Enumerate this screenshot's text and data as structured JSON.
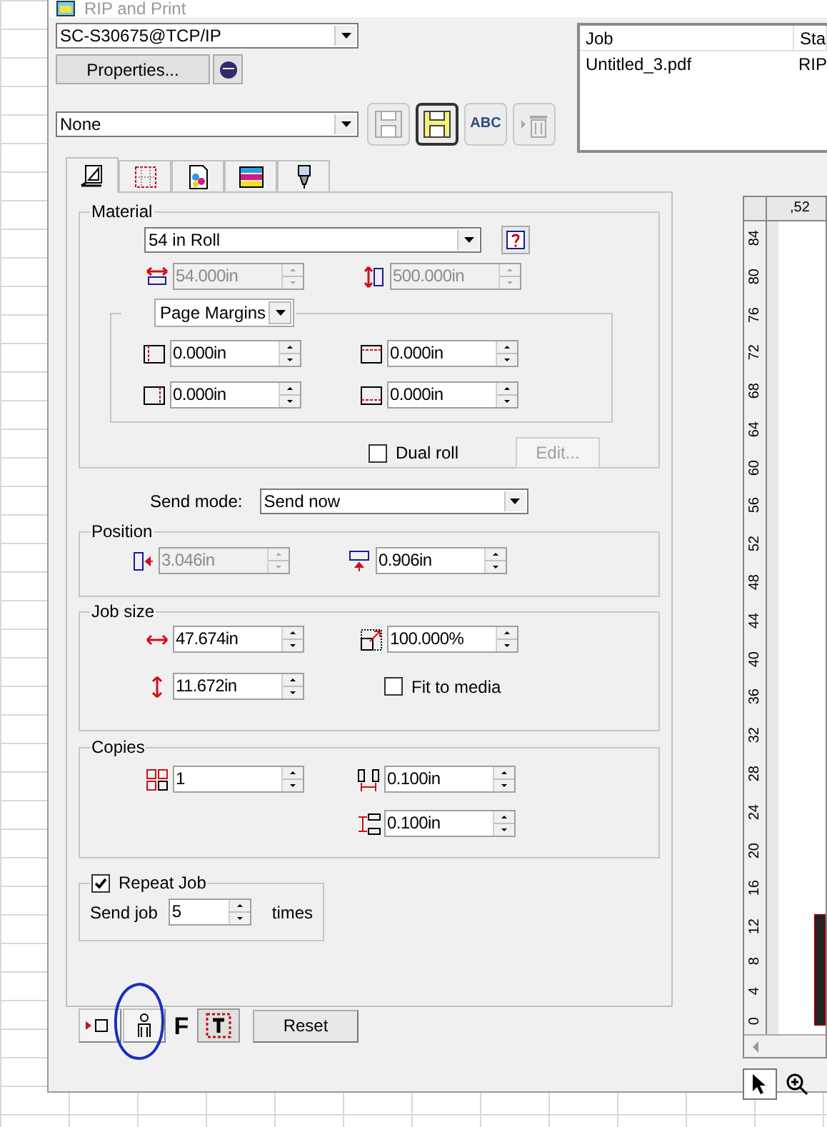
{
  "window": {
    "title": "RIP and Print"
  },
  "printer": {
    "value": "SC-S30675@TCP/IP"
  },
  "properties_button": "Properties...",
  "preset": {
    "value": "None"
  },
  "preset_tools": [
    {
      "kind": "save",
      "disabled": true,
      "selected": false
    },
    {
      "kind": "save-as",
      "disabled": false,
      "selected": true
    },
    {
      "kind": "rename",
      "label": "ABC",
      "disabled": false,
      "selected": false
    },
    {
      "kind": "delete",
      "disabled": true,
      "selected": false
    }
  ],
  "tabs": [
    {
      "kind": "layout",
      "selected": true
    },
    {
      "kind": "margins",
      "selected": false
    },
    {
      "kind": "color",
      "selected": false
    },
    {
      "kind": "calibration",
      "selected": false
    },
    {
      "kind": "cutting",
      "selected": false
    }
  ],
  "material": {
    "title": "Material",
    "media": "54 in Roll",
    "fields": [
      {
        "kind": "width",
        "value": "54.000in",
        "disabled": true
      },
      {
        "kind": "length",
        "value": "500.000in",
        "disabled": true
      }
    ],
    "margins": {
      "mode": "Page Margins",
      "fields": [
        {
          "kind": "left",
          "value": "0.000in",
          "disabled": false
        },
        {
          "kind": "top",
          "value": "0.000in",
          "disabled": false
        },
        {
          "kind": "right",
          "value": "0.000in",
          "disabled": false
        },
        {
          "kind": "bottom",
          "value": "0.000in",
          "disabled": false
        }
      ]
    },
    "dual_roll": {
      "label": "Dual roll",
      "checked": false
    },
    "edit_button": {
      "label": "Edit...",
      "disabled": true
    }
  },
  "send_mode": {
    "label": "Send mode:",
    "value": "Send now"
  },
  "position": {
    "title": "Position",
    "fields": [
      {
        "kind": "x",
        "value": "3.046in",
        "disabled": true
      },
      {
        "kind": "y",
        "value": "0.906in",
        "disabled": false
      }
    ]
  },
  "job_size": {
    "title": "Job size",
    "fields": [
      {
        "kind": "resize-width",
        "value": "47.674in",
        "disabled": false
      },
      {
        "kind": "scale",
        "value": "100.000%",
        "disabled": false
      },
      {
        "kind": "resize-height",
        "value": "11.672in",
        "disabled": false
      }
    ],
    "fit_to_media": {
      "label": "Fit to media",
      "checked": false
    }
  },
  "copies": {
    "title": "Copies",
    "fields": [
      {
        "kind": "count",
        "value": "1",
        "disabled": false
      },
      {
        "kind": "h-gap",
        "value": "0.100in",
        "disabled": false
      },
      {
        "kind": "v-gap",
        "value": "0.100in",
        "disabled": false
      }
    ]
  },
  "repeat_job": {
    "label": "Repeat Job",
    "checked": true,
    "prefix": "Send job",
    "value": "5",
    "suffix": "times"
  },
  "bottom_tools": [
    {
      "kind": "origin",
      "selected": false,
      "circled": false
    },
    {
      "kind": "person",
      "selected": false,
      "circled": true
    },
    {
      "kind": "font",
      "label": "F",
      "selected": false,
      "circled": false
    },
    {
      "kind": "text-frame",
      "selected": true,
      "circled": false
    }
  ],
  "reset_button": "Reset",
  "job_list": {
    "columns": [
      "Job",
      "Sta"
    ],
    "rows": [
      [
        "Untitled_3.pdf",
        "RIP"
      ]
    ]
  },
  "preview": {
    "top_ruler": ",52",
    "side_ruler": [
      "84",
      "80",
      "76",
      "72",
      "68",
      "64",
      "60",
      "56",
      "52",
      "48",
      "44",
      "40",
      "36",
      "32",
      "28",
      "24",
      "20",
      "16",
      "12",
      "8",
      "4",
      "0"
    ]
  },
  "preview_tools": [
    {
      "kind": "pointer",
      "selected": true
    },
    {
      "kind": "zoom",
      "selected": false
    }
  ]
}
